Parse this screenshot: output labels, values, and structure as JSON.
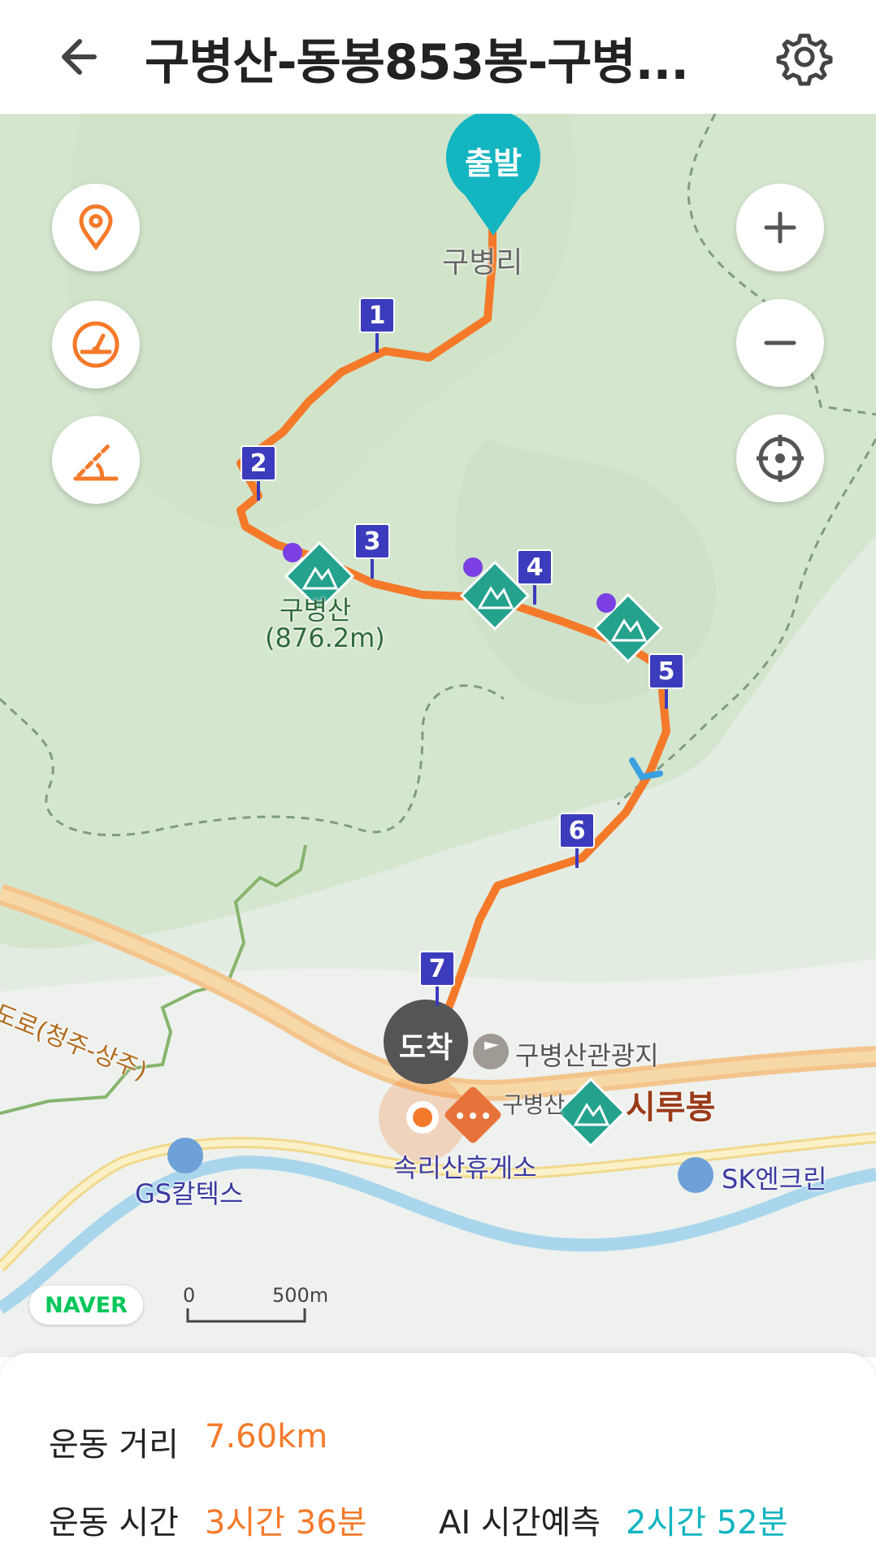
{
  "header": {
    "title": "구병산-동봉853봉-구병...",
    "back_icon": "arrow-left-icon",
    "settings_icon": "gear-icon"
  },
  "map": {
    "start_label": "출발",
    "end_label": "도착",
    "waypoints": [
      "1",
      "2",
      "3",
      "4",
      "5",
      "6",
      "7"
    ],
    "labels": {
      "village": "구병리",
      "peak_name": "구병산",
      "peak_elevation": "(876.2m)",
      "highway": "당진영덕고속도로(청주-상주)",
      "tourist_site": "구병산관광지",
      "tourist_site2": "구병산",
      "peak2": "시루봉",
      "rest_area": "속리산휴게소",
      "gas1": "GS칼텍스",
      "gas2": "SK엔크린"
    },
    "scale_zero": "0",
    "scale_value": "500m",
    "provider": "NAVER"
  },
  "controls": {
    "left": [
      "location-pin-icon",
      "speedometer-icon",
      "slope-icon"
    ],
    "right": [
      "zoom-in-icon",
      "zoom-out-icon",
      "crosshair-icon"
    ]
  },
  "stats": {
    "distance_label": "운동 거리",
    "distance_value": "7.60km",
    "time_label": "운동 시간",
    "time_value": "3시간 36분",
    "ai_label": "AI 시간예측",
    "ai_value": "2시간 52분"
  },
  "colors": {
    "route": "#f47a2a",
    "marker": "#3b3bbd",
    "start_pin": "#13b5c1",
    "peak": "#24a28e",
    "stat_orange": "#f47a2a",
    "stat_teal": "#13b5c1"
  }
}
